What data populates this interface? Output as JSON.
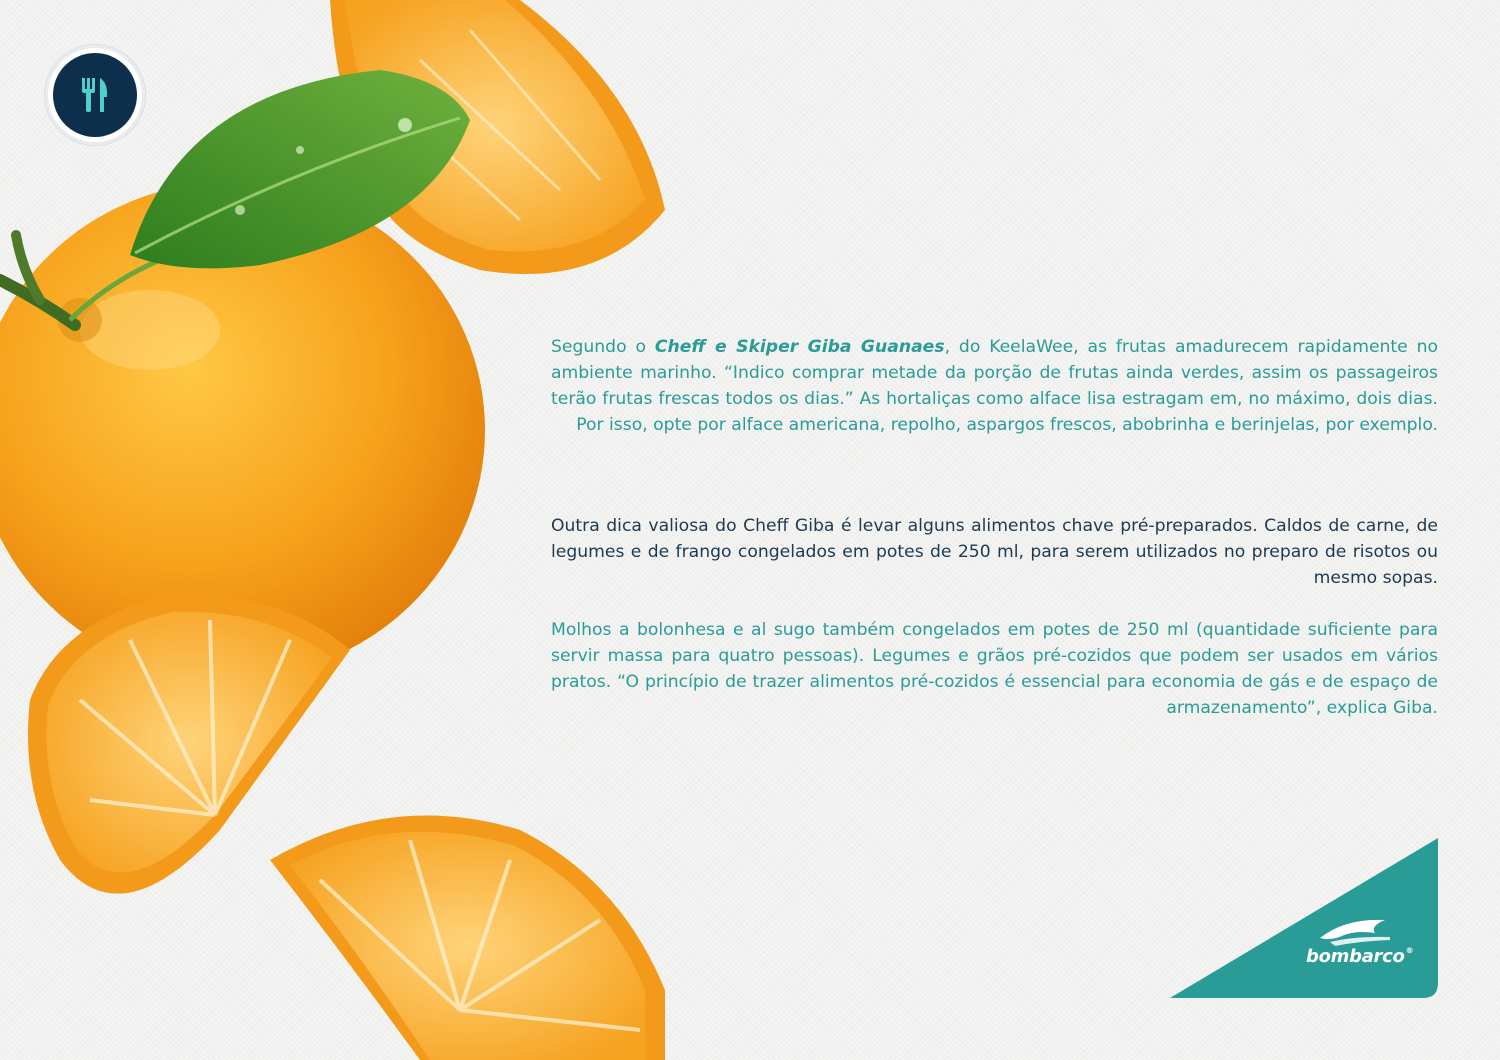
{
  "icons": {
    "badge": "fork-knife-icon",
    "logo": "bombarco-wave-icon"
  },
  "colors": {
    "teal": "#2a9c97",
    "navy": "#1c3a52",
    "badge": "#0e2f4c",
    "orange": "#f39a1a"
  },
  "article": {
    "p1_intro": "Segundo o ",
    "p1_highlight": "Cheff e Skiper Giba Guanaes",
    "p1_rest": ", do KeelaWee, as frutas amadurecem rapidamente no ambiente marinho. “Indico comprar metade da porção de frutas ainda verdes, assim os passageiros terão frutas frescas todos os dias.” As hortaliças como alface lisa estragam em, no máximo, dois dias. Por isso, opte por alface americana, repolho, aspargos frescos, abobrinha e berinjelas, por exemplo.",
    "p2": "Outra dica valiosa do Cheff Giba é levar alguns alimentos chave pré-preparados. Caldos de carne, de legumes e de frango congelados em potes de 250 ml, para serem utilizados no preparo de risotos ou mesmo sopas.",
    "p3": "Molhos a bolonhesa e al sugo também congelados em potes de 250 ml (quantidade suficiente para servir massa para quatro pessoas). Legumes e grãos pré-cozidos que podem ser usados em vários pratos. “O princípio de trazer alimentos pré-cozidos é essencial para economia de gás e de espaço de armazenamento”, explica Giba."
  },
  "brand": {
    "logo_text": "bombarco",
    "registered": "®"
  }
}
